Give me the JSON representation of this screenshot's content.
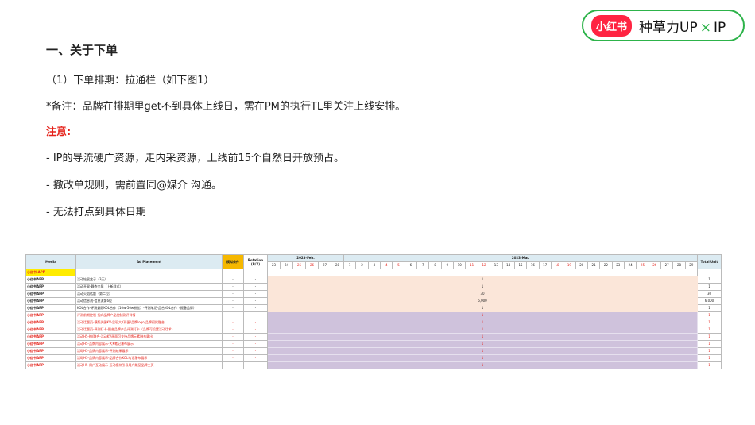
{
  "logo": {
    "badge": "小红书",
    "text": "种草力UP",
    "x": "×",
    "ip": "IP"
  },
  "heading": "一、关于下单",
  "lines": [
    "（1）下单排期：拉通栏（如下图1）",
    "*备注：品牌在排期里get不到具体上线日，需在PM的执行TL里关注上线安排。",
    "注意:",
    "- IP的导流硬广资源，走内采资源，上线前15个自然日开放预占。",
    "- 撤改单规则，需前置同@媒介 沟通。",
    "- 无法打点到具体日期"
  ],
  "table": {
    "headers": {
      "media": "Media",
      "placement": "Ad Placement",
      "cond": "模拟条件",
      "rotation": "Rotation (B/X)",
      "feb": "2023-Feb.",
      "mar": "2023-Mar.",
      "total": "Total Unit"
    },
    "feb_days": [
      "23",
      "24",
      "25",
      "26",
      "27",
      "28"
    ],
    "feb_weekend": [
      "25",
      "26"
    ],
    "mar_days": [
      "1",
      "2",
      "3",
      "4",
      "5",
      "6",
      "7",
      "8",
      "9",
      "10",
      "11",
      "12",
      "13",
      "14",
      "15",
      "16",
      "17",
      "18",
      "19",
      "20",
      "21",
      "22",
      "23",
      "24",
      "25",
      "26",
      "27",
      "28",
      "29"
    ],
    "mar_weekend": [
      "4",
      "5",
      "11",
      "12",
      "18",
      "19",
      "25",
      "26"
    ],
    "section": "小红书-APP",
    "rows": [
      {
        "media": "小红书APP",
        "placement": "活动钻展盒子（3天）",
        "cond": "-",
        "rot": "-",
        "value": "1",
        "total": "1",
        "type": "standard"
      },
      {
        "media": "小红书APP",
        "placement": "活动开屏-静态全屏（上新样式）",
        "cond": "-",
        "rot": "-",
        "value": "1",
        "total": "1",
        "type": "standard"
      },
      {
        "media": "小红书APP",
        "placement": "活动火焰话题（第二位）",
        "cond": "-",
        "rot": "-",
        "value": "30",
        "total": "30",
        "type": "standard"
      },
      {
        "media": "小红书APP",
        "placement": "活动信息流-信息流第6位",
        "cond": "-",
        "rot": "-",
        "value": "6,000",
        "total": "6,000",
        "type": "standard"
      },
      {
        "media": "小红书APP",
        "placement": "KOL合作-评测兼顾KOL合作（10w-50w粉丝）-评测笔记-品合KOL合作（报备品牌）",
        "cond": "-",
        "rot": "-",
        "value": "1",
        "total": "1",
        "type": "standard"
      },
      {
        "media": "小红书APP",
        "placement": "评测前期控制-指向品牌产品控制测评详情",
        "cond": "-",
        "rot": "-",
        "value": "1",
        "total": "1",
        "type": "bonus"
      },
      {
        "media": "小红书APP",
        "placement": "活动话题页-横版头图KV-呈现大K彩蛋/品牌logo/品牌视觉融合",
        "cond": "-",
        "rot": "-",
        "value": "1",
        "total": "1",
        "type": "bonus"
      },
      {
        "media": "小红书APP",
        "placement": "活动话题页-评测打卡-配合品牌产品评测打卡（品牌可设置活动话术）",
        "cond": "-",
        "rot": "-",
        "value": "1",
        "total": "1",
        "type": "bonus"
      },
      {
        "media": "小红书APP",
        "placement": "活动H5-KV融合-活动KV画面可支持品牌元素融合露出",
        "cond": "-",
        "rot": "-",
        "value": "1",
        "total": "1",
        "type": "bonus"
      },
      {
        "media": "小红书APP",
        "placement": "活动H5-品牌内容展示-大K笔记瀑布展示",
        "cond": "-",
        "rot": "-",
        "value": "1",
        "total": "1",
        "type": "bonus"
      },
      {
        "media": "小红书APP",
        "placement": "活动H5-品牌内容展示-评测结果展示",
        "cond": "-",
        "rot": "-",
        "value": "1",
        "total": "1",
        "type": "bonus"
      },
      {
        "media": "小红书APP",
        "placement": "活动H5-品牌内容展示-品牌合作KOL笔记瀑布展示",
        "cond": "-",
        "rot": "-",
        "value": "1",
        "total": "1",
        "type": "bonus"
      },
      {
        "media": "小红书APP",
        "placement": "活动H5-用户互动展示-互动模块引导用户跳至品牌主页",
        "cond": "-",
        "rot": "-",
        "value": "1",
        "total": "1",
        "type": "bonus"
      }
    ]
  }
}
